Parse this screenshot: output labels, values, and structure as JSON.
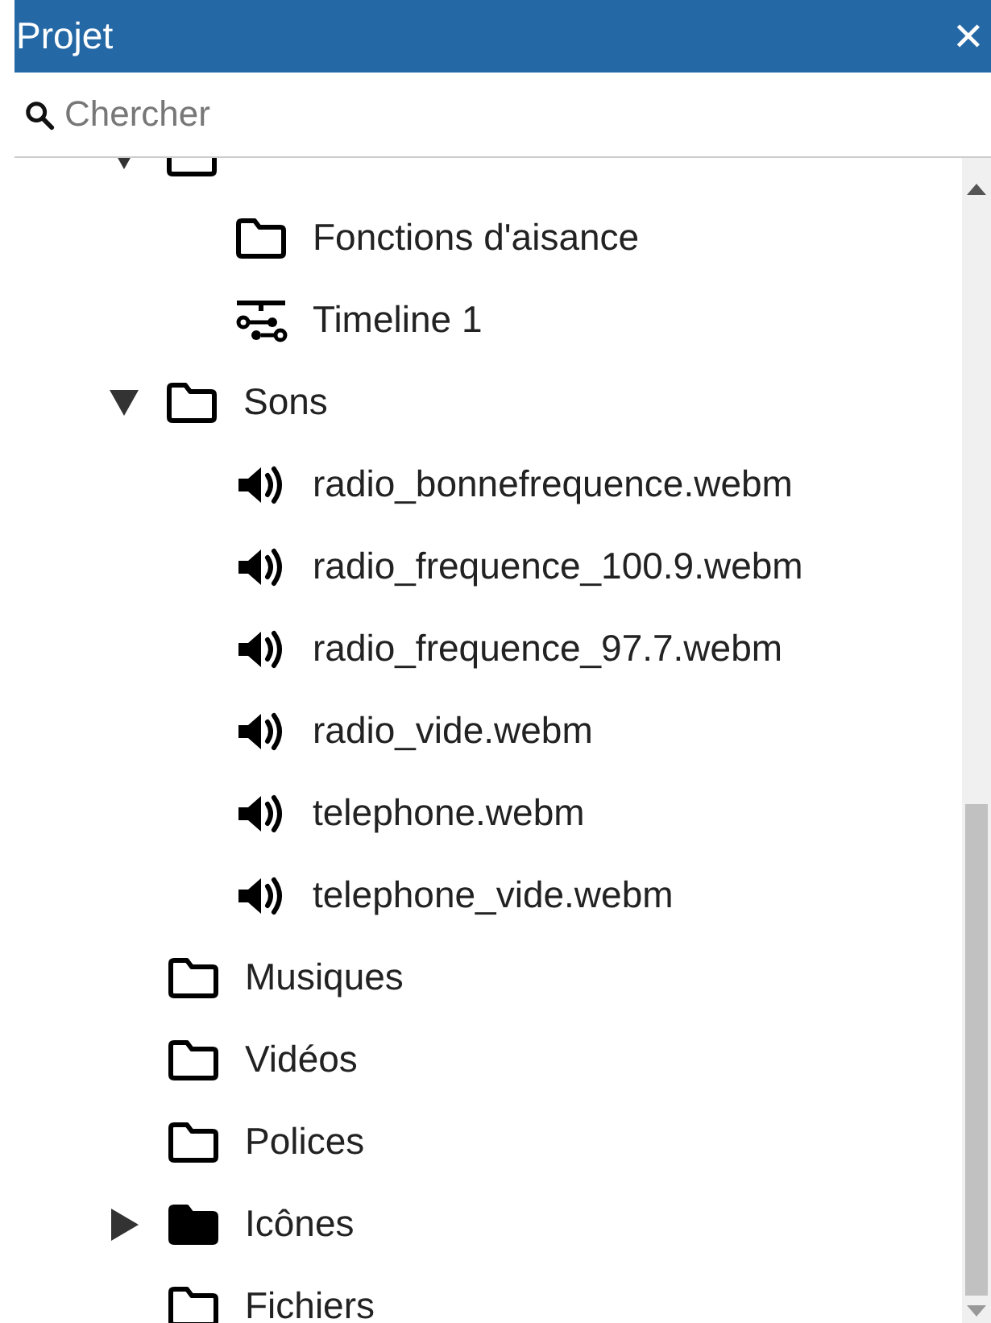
{
  "panel": {
    "title": "Projet",
    "close": "✕"
  },
  "search": {
    "placeholder": "Chercher"
  },
  "tree": [
    {
      "kind": "folder",
      "expanded": true,
      "children": [
        {
          "kind": "folder",
          "label": "Fonctions d'aisance"
        },
        {
          "kind": "timeline",
          "label": "Timeline 1"
        }
      ]
    },
    {
      "kind": "folder",
      "label": "Sons",
      "expanded": true,
      "children": [
        {
          "kind": "sound",
          "label": "radio_bonnefrequence.webm"
        },
        {
          "kind": "sound",
          "label": "radio_frequence_100.9.webm"
        },
        {
          "kind": "sound",
          "label": "radio_frequence_97.7.webm"
        },
        {
          "kind": "sound",
          "label": "radio_vide.webm"
        },
        {
          "kind": "sound",
          "label": "telephone.webm"
        },
        {
          "kind": "sound",
          "label": "telephone_vide.webm"
        }
      ]
    },
    {
      "kind": "folder",
      "label": "Musiques"
    },
    {
      "kind": "folder",
      "label": "Vidéos"
    },
    {
      "kind": "folder",
      "label": "Polices"
    },
    {
      "kind": "folder",
      "label": "Icônes",
      "expanded": false
    },
    {
      "kind": "folder",
      "label": "Fichiers"
    }
  ]
}
